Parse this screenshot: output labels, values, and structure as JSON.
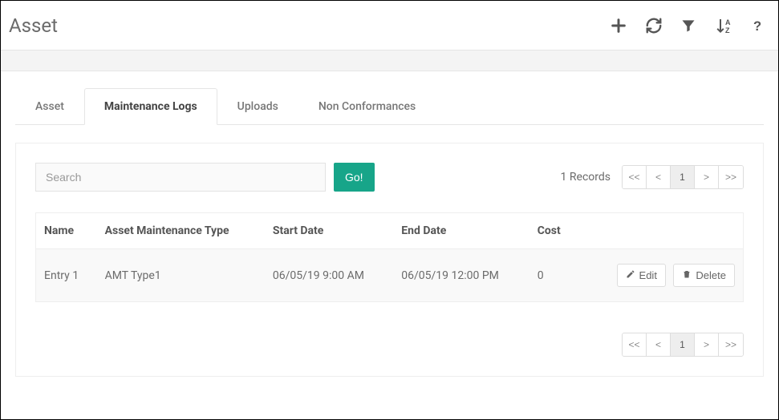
{
  "header": {
    "title": "Asset"
  },
  "tabs": [
    {
      "id": "asset",
      "label": "Asset",
      "active": false
    },
    {
      "id": "maintenance",
      "label": "Maintenance Logs",
      "active": true
    },
    {
      "id": "uploads",
      "label": "Uploads",
      "active": false
    },
    {
      "id": "nonconf",
      "label": "Non Conformances",
      "active": false
    }
  ],
  "search": {
    "placeholder": "Search",
    "goLabel": "Go!"
  },
  "recordsLabel": "1 Records",
  "pager": {
    "first": "<<",
    "prev": "<",
    "current": "1",
    "next": ">",
    "last": ">>"
  },
  "table": {
    "headers": {
      "name": "Name",
      "type": "Asset Maintenance Type",
      "start": "Start Date",
      "end": "End Date",
      "cost": "Cost"
    },
    "rows": [
      {
        "name": "Entry 1",
        "type": "AMT Type1",
        "start": "06/05/19 9:00 AM",
        "end": "06/05/19 12:00 PM",
        "cost": "0"
      }
    ],
    "actions": {
      "edit": "Edit",
      "delete": "Delete"
    }
  }
}
